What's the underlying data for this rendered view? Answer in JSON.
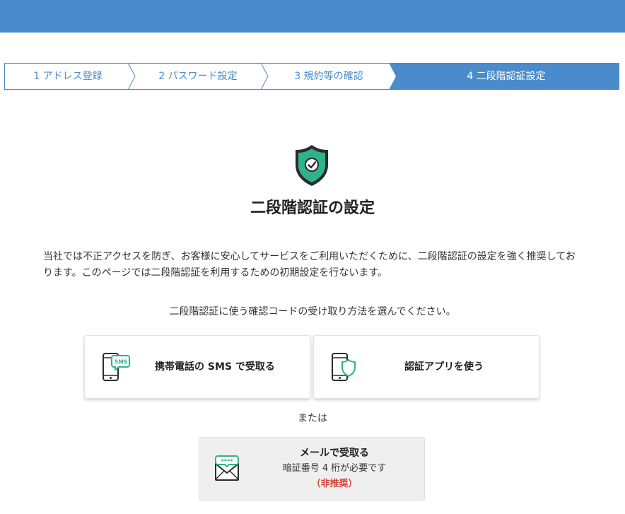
{
  "steps": [
    {
      "label": "1 アドレス登録"
    },
    {
      "label": "2 パスワード設定"
    },
    {
      "label": "3 規約等の確認"
    },
    {
      "label": "4 二段階認証設定"
    }
  ],
  "main": {
    "title": "二段階認証の設定",
    "intro_line1": "当社では不正アクセスを防ぎ、お客様に安心してサービスをご利用いただくために、二段階認証の設定を強く推奨してお",
    "intro_line2": "ります。このページでは二段階認証を利用するための初期設定を行ないます。",
    "instruction": "二段階認証に使う確認コードの受け取り方法を選んでください。"
  },
  "options": {
    "sms": {
      "label": "携帯電話の SMS で受取る",
      "badge": "SMS"
    },
    "app": {
      "label": "認証アプリを使う"
    },
    "or": "または",
    "mail": {
      "title": "メールで受取る",
      "note": "暗証番号 4 桁が必要です",
      "warning": "（非推奨）",
      "badge": "****"
    }
  },
  "colors": {
    "primary": "#4a8ccb",
    "shield_green": "#2fb38a",
    "icon_dark": "#2b2b2b",
    "warning": "#d6453c"
  }
}
